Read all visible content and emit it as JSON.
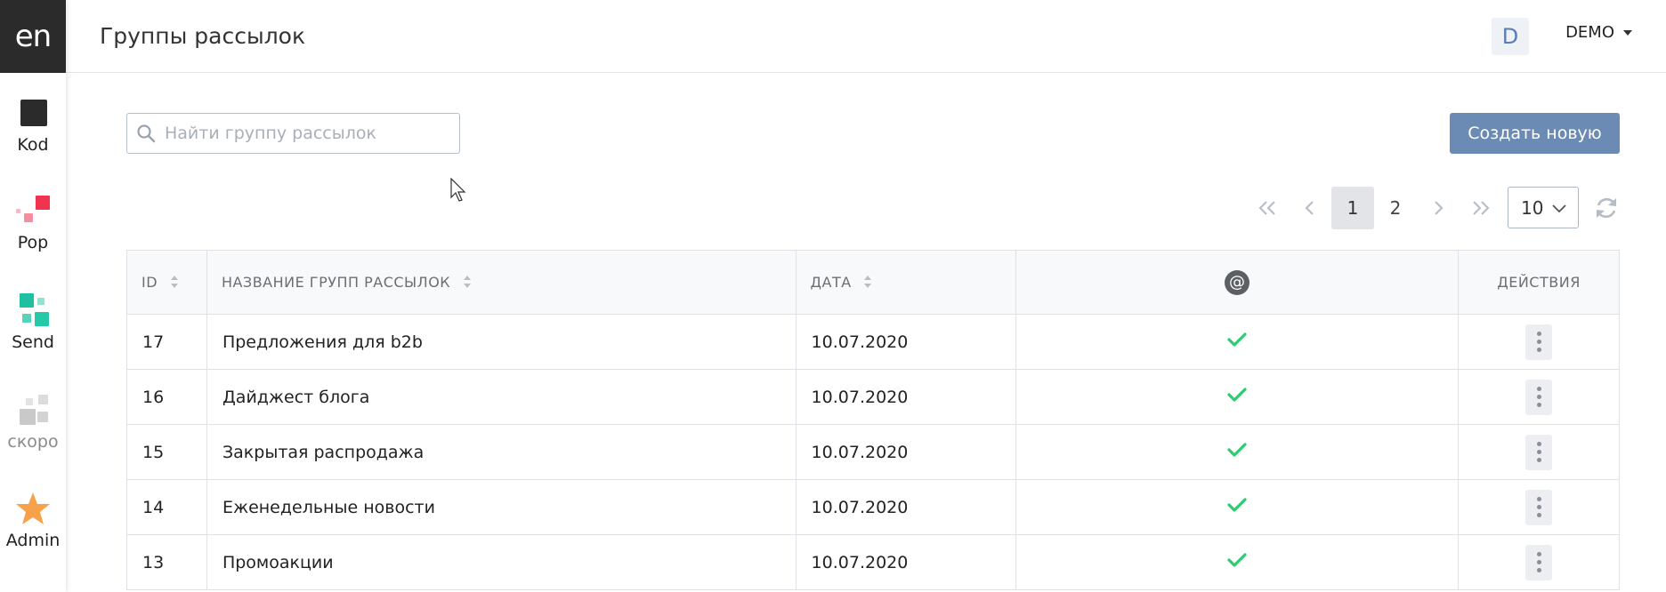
{
  "app": {
    "logo_text": "en"
  },
  "sidebar": {
    "items": [
      {
        "label": "Kod",
        "icon": "kod-square-icon"
      },
      {
        "label": "Pop",
        "icon": "pop-squares-icon"
      },
      {
        "label": "Send",
        "icon": "send-squares-icon"
      },
      {
        "label": "скоро",
        "icon": "soon-squares-icon"
      },
      {
        "label": "Admin",
        "icon": "star-icon"
      }
    ]
  },
  "header": {
    "title": "Группы рассылок",
    "avatar_letter": "D",
    "user_name": "DEMO"
  },
  "search": {
    "placeholder": "Найти группу рассылок",
    "value": ""
  },
  "toolbar": {
    "create_label": "Создать новую"
  },
  "pagination": {
    "pages": [
      "1",
      "2"
    ],
    "current": "1",
    "per_page": "10"
  },
  "table": {
    "headers": {
      "id": "ID",
      "name": "НАЗВАНИЕ ГРУПП РАССЫЛОК",
      "date": "ДАТА",
      "email": "@",
      "actions": "ДЕЙСТВИЯ"
    },
    "rows": [
      {
        "id": "17",
        "name": "Предложения для b2b",
        "date": "10.07.2020",
        "email": true
      },
      {
        "id": "16",
        "name": "Дайджест блога",
        "date": "10.07.2020",
        "email": true
      },
      {
        "id": "15",
        "name": "Закрытая распродажа",
        "date": "10.07.2020",
        "email": true
      },
      {
        "id": "14",
        "name": "Еженедельные новости",
        "date": "10.07.2020",
        "email": true
      },
      {
        "id": "13",
        "name": "Промоакции",
        "date": "10.07.2020",
        "email": true
      }
    ]
  },
  "colors": {
    "accent": "#6b8bb4",
    "check": "#2ecc71",
    "pop": "#f0344f",
    "send": "#1fc0a0",
    "admin_star": "#f7a24a"
  }
}
